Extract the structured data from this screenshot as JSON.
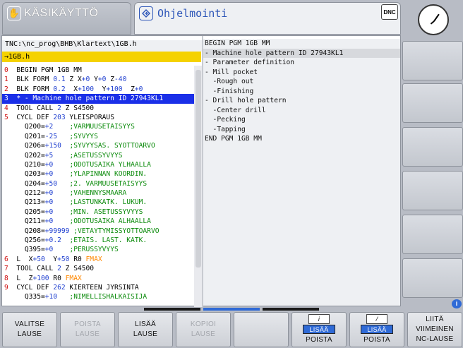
{
  "header": {
    "manual_mode": "KÄSIKÄYTTÖ",
    "program_mode": "Ohjelmointi",
    "dnc": "DNC"
  },
  "editor": {
    "path": "TNC:\\nc_prog\\BHB\\Klartext\\1GB.h",
    "file_name": "→1GB.h",
    "lines": [
      [
        [
          "n",
          "0"
        ],
        [
          "t",
          "  BEGIN PGM 1GB MM"
        ]
      ],
      [
        [
          "n",
          "1"
        ],
        [
          "t",
          "  BLK FORM "
        ],
        [
          "b",
          "0.1"
        ],
        [
          "t",
          " Z X"
        ],
        [
          "b",
          "+0"
        ],
        [
          "t",
          " Y"
        ],
        [
          "b",
          "+0"
        ],
        [
          "t",
          " Z"
        ],
        [
          "b",
          "-40"
        ]
      ],
      [
        [
          "n",
          "2"
        ],
        [
          "t",
          "  BLK FORM "
        ],
        [
          "b",
          "0.2"
        ],
        [
          "t",
          "  X"
        ],
        [
          "b",
          "+100"
        ],
        [
          "t",
          "  Y"
        ],
        [
          "b",
          "+100"
        ],
        [
          "t",
          "  Z"
        ],
        [
          "b",
          "+0"
        ]
      ],
      [
        [
          "n",
          "3"
        ],
        [
          "t",
          "  * - Machine hole pattern ID 27943KL1"
        ]
      ],
      [
        [
          "n",
          "4"
        ],
        [
          "t",
          "  TOOL CALL "
        ],
        [
          "b",
          "2"
        ],
        [
          "t",
          " Z S4500"
        ]
      ],
      [
        [
          "n",
          "5"
        ],
        [
          "t",
          "  CYCL DEF "
        ],
        [
          "b",
          "203"
        ],
        [
          "t",
          " YLEISPORAUS"
        ]
      ],
      [
        [
          "t",
          "     Q200="
        ],
        [
          "b",
          "+2"
        ],
        [
          "t",
          "    "
        ],
        [
          "g",
          ";VARMUUSETAISYYS"
        ]
      ],
      [
        [
          "t",
          "     Q201="
        ],
        [
          "b",
          "-25"
        ],
        [
          "t",
          "   "
        ],
        [
          "g",
          ";SYVYYS"
        ]
      ],
      [
        [
          "t",
          "     Q206="
        ],
        [
          "b",
          "+150"
        ],
        [
          "t",
          "  "
        ],
        [
          "g",
          ";SYVYYSAS. SYOTTOARVO"
        ]
      ],
      [
        [
          "t",
          "     Q202="
        ],
        [
          "b",
          "+5"
        ],
        [
          "t",
          "    "
        ],
        [
          "g",
          ";ASETUSSYVYYS"
        ]
      ],
      [
        [
          "t",
          "     Q210="
        ],
        [
          "b",
          "+0"
        ],
        [
          "t",
          "    "
        ],
        [
          "g",
          ";ODOTUSAIKA YLHAALLA"
        ]
      ],
      [
        [
          "t",
          "     Q203="
        ],
        [
          "b",
          "+0"
        ],
        [
          "t",
          "    "
        ],
        [
          "g",
          ";YLAPINNAN KOORDIN."
        ]
      ],
      [
        [
          "t",
          "     Q204="
        ],
        [
          "b",
          "+50"
        ],
        [
          "t",
          "   "
        ],
        [
          "g",
          ";2. VARMUUSETAISYYS"
        ]
      ],
      [
        [
          "t",
          "     Q212="
        ],
        [
          "b",
          "+0"
        ],
        [
          "t",
          "    "
        ],
        [
          "g",
          ";VAHENNYSMAARA"
        ]
      ],
      [
        [
          "t",
          "     Q213="
        ],
        [
          "b",
          "+0"
        ],
        [
          "t",
          "    "
        ],
        [
          "g",
          ";LASTUNKATK. LUKUM."
        ]
      ],
      [
        [
          "t",
          "     Q205="
        ],
        [
          "b",
          "+0"
        ],
        [
          "t",
          "    "
        ],
        [
          "g",
          ";MIN. ASETUSSYVYYS"
        ]
      ],
      [
        [
          "t",
          "     Q211="
        ],
        [
          "b",
          "+0"
        ],
        [
          "t",
          "    "
        ],
        [
          "g",
          ";ODOTUSAIKA ALHAALLA"
        ]
      ],
      [
        [
          "t",
          "     Q208="
        ],
        [
          "b",
          "+99999"
        ],
        [
          "t",
          " "
        ],
        [
          "g",
          ";VETAYTYMISSYOTTOARVO"
        ]
      ],
      [
        [
          "t",
          "     Q256="
        ],
        [
          "b",
          "+0.2"
        ],
        [
          "t",
          "  "
        ],
        [
          "g",
          ";ETAIS. LAST. KATK."
        ]
      ],
      [
        [
          "t",
          "     Q395="
        ],
        [
          "b",
          "+0"
        ],
        [
          "t",
          "    "
        ],
        [
          "g",
          ";PERUSSYVYYS"
        ]
      ],
      [
        [
          "n",
          "6"
        ],
        [
          "t",
          "  L  X"
        ],
        [
          "b",
          "+50"
        ],
        [
          "t",
          "  Y"
        ],
        [
          "b",
          "+50"
        ],
        [
          "t",
          " R0 "
        ],
        [
          "o",
          "FMAX"
        ]
      ],
      [
        [
          "n",
          "7"
        ],
        [
          "t",
          "  TOOL CALL "
        ],
        [
          "b",
          "2"
        ],
        [
          "t",
          " Z S4500"
        ]
      ],
      [
        [
          "n",
          "8"
        ],
        [
          "t",
          "  L  Z"
        ],
        [
          "b",
          "+100"
        ],
        [
          "t",
          " R0 "
        ],
        [
          "o",
          "FMAX"
        ]
      ],
      [
        [
          "n",
          "9"
        ],
        [
          "t",
          "  CYCL DEF "
        ],
        [
          "b",
          "262"
        ],
        [
          "t",
          " KIERTEEN JYRSINTA"
        ]
      ],
      [
        [
          "t",
          "     Q335="
        ],
        [
          "b",
          "+10"
        ],
        [
          "t",
          "   "
        ],
        [
          "g",
          ";NIMELLISHALKAISIJA"
        ]
      ]
    ],
    "selected_line": 3
  },
  "structure": [
    "BEGIN PGM 1GB MM",
    "- Machine hole pattern ID 27943KL1",
    "- Parameter definition",
    "- Mill pocket",
    "  -Rough out",
    "  -Finishing",
    "- Drill hole pattern",
    "  -Center drill",
    "  -Pecking",
    "  -Tapping",
    "END PGM 1GB MM"
  ],
  "softkeys": [
    {
      "l1": "VALITSE",
      "l2": "LAUSE",
      "disabled": false
    },
    {
      "l1": "POISTA",
      "l2": "LAUSE",
      "disabled": true
    },
    {
      "l1": "LISÄÄ",
      "l2": "LAUSE",
      "disabled": false
    },
    {
      "l1": "KOPIOI",
      "l2": "LAUSE",
      "disabled": true
    },
    {
      "l1": "",
      "l2": "",
      "disabled": false
    },
    {
      "blue": "LISÄÄ",
      "l2": "POISTA",
      "icon": "i"
    },
    {
      "blue": "LISÄÄ",
      "l2": "POISTA",
      "icon": "/"
    },
    {
      "l1": "LIITÄ",
      "l2": "VIIMEINEN",
      "l3": "NC-LAUSE"
    }
  ],
  "info_badge": "i"
}
